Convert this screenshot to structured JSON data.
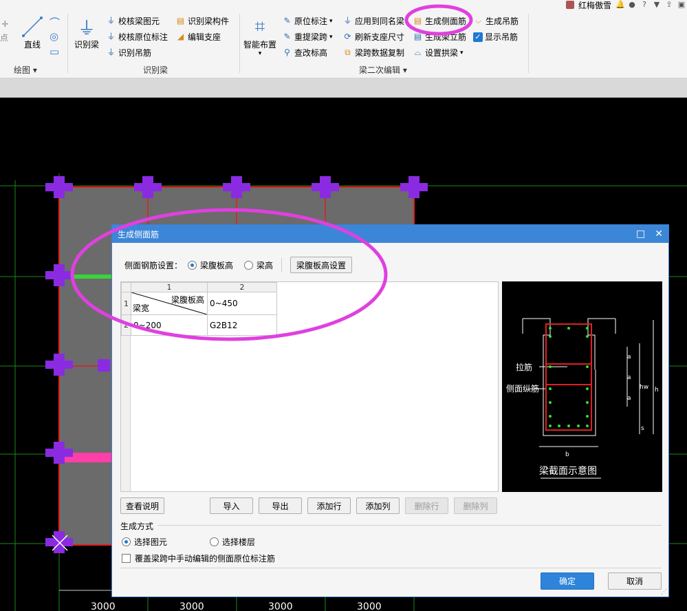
{
  "topbar": {
    "user_name": "红梅傲雪",
    "icons": [
      "bell-icon",
      "chat-icon",
      "help-icon",
      "shirt-icon",
      "export-icon",
      "window-icon"
    ]
  },
  "ribbon": {
    "draw_group": {
      "label": "绘图",
      "items": {
        "point": "点",
        "line": "直线"
      }
    },
    "recognize_group": {
      "label": "识别梁",
      "big_button": "识别梁",
      "items": {
        "check_beam": "校核梁图元",
        "check_original": "校核原位标注",
        "recognize_hanger": "识别吊筋",
        "recognize_member": "识别梁构件",
        "edit_support": "编辑支座"
      }
    },
    "edit_group": {
      "label": "梁二次编辑",
      "big_button": "智能布置",
      "items": {
        "original_mark": "原位标注",
        "reextract_span": "重提梁跨",
        "modify_elev": "查改标高",
        "apply_same": "应用到同名梁",
        "refresh_support": "刷新支座尺寸",
        "span_copy": "梁跨数据复制",
        "gen_side_rebar": "生成侧面筋",
        "gen_stirrup": "生成架立筋",
        "set_arch": "设置拱梁",
        "gen_hanger": "生成吊筋",
        "show_hanger": "显示吊筋"
      }
    }
  },
  "dialog": {
    "title": "生成侧面筋",
    "setting_label": "侧面钢筋设置：",
    "radio_web_height": "梁腹板高",
    "radio_beam_height": "梁高",
    "web_height_setting_button": "梁腹板高设置",
    "table": {
      "col_numbers": [
        "1",
        "2"
      ],
      "row_numbers": [
        "1",
        "2"
      ],
      "corner_top": "梁腹板高",
      "corner_bottom": "梁宽",
      "header_value": "0~450",
      "row_label": "0~200",
      "row_value": "G2B12"
    },
    "preview": {
      "caption": "梁截面示意图",
      "labels": {
        "tie": "拉筋",
        "side_long": "侧面纵筋",
        "a": "a",
        "hw": "hw",
        "h": "h",
        "s": "s",
        "b": "b"
      }
    },
    "buttons": {
      "view_help": "查看说明",
      "import": "导入",
      "export": "导出",
      "add_row": "添加行",
      "add_col": "添加列",
      "delete_row": "删除行",
      "delete_col": "删除列"
    },
    "mode": {
      "title": "生成方式",
      "option_select_element": "选择图元",
      "option_select_floor": "选择楼层",
      "selected": "选择图元",
      "overwrite_label": "覆盖梁跨中手动编辑的侧面原位标注筋",
      "overwrite_checked": false
    },
    "ok": "确定",
    "cancel": "取消"
  },
  "canvas": {
    "dimensions": [
      "3000",
      "3000",
      "3000",
      "3000"
    ],
    "colors": {
      "grid": "#1b8a1b",
      "beam": "#e02020",
      "column": "#8a2be2",
      "slab": "#6b6b6b",
      "highlight": "#e040e0"
    }
  }
}
